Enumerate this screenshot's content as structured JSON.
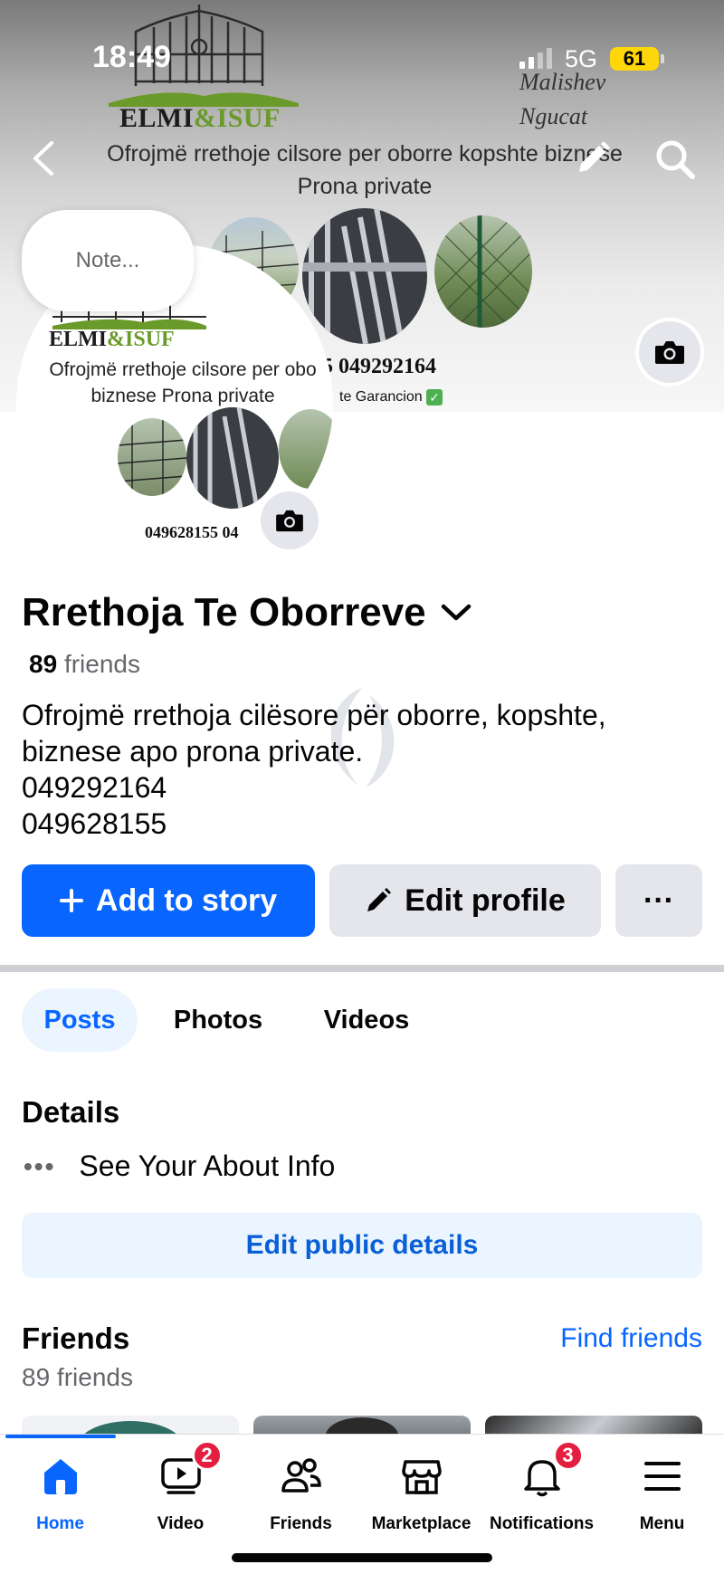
{
  "status_bar": {
    "time": "18:49",
    "network": "5G",
    "battery": "61"
  },
  "cover": {
    "brand_name": "ELMI",
    "brand_amp": "&",
    "brand_name_2": "ISUF",
    "tagline": "Ofrojmë rrethoje cilsore per oborre kopshte biznese Prona private",
    "handwritten_line1": "Malishev",
    "handwritten_line2": "Ngucat",
    "phone": "55  049292164",
    "garancion": "te Garancion"
  },
  "profile_picture": {
    "brand_name": "ELMI",
    "brand_amp": "&",
    "brand_name_2": "ISUF",
    "tagline": "Ofrojmë rrethoje cilsore per obo biznese Prona private",
    "phone": "049628155  04"
  },
  "note": {
    "placeholder": "Note..."
  },
  "profile": {
    "name": "Rrethoja Te Oborreve",
    "friends_count": "89",
    "friends_label": "friends",
    "bio_lines": [
      "Ofrojmë rrethoja cilësore për oborre, kopshte,",
      "biznese apo prona private.",
      "049292164",
      "049628155"
    ]
  },
  "actions": {
    "add_to_story": "Add to story",
    "edit_profile": "Edit profile",
    "more": "···"
  },
  "tabs": [
    "Posts",
    "Photos",
    "Videos"
  ],
  "details": {
    "title": "Details",
    "about_dots": "•••",
    "about_link": "See Your About Info",
    "edit_button": "Edit public details"
  },
  "friends_section": {
    "title": "Friends",
    "find_friends": "Find friends",
    "count_text": "89 friends"
  },
  "bottom_nav": {
    "items": [
      {
        "label": "Home",
        "icon": "home-icon",
        "active": true
      },
      {
        "label": "Video",
        "icon": "video-icon",
        "badge": "2"
      },
      {
        "label": "Friends",
        "icon": "friends-icon"
      },
      {
        "label": "Marketplace",
        "icon": "marketplace-icon"
      },
      {
        "label": "Notifications",
        "icon": "bell-icon",
        "badge": "3"
      },
      {
        "label": "Menu",
        "icon": "menu-icon"
      }
    ]
  },
  "colors": {
    "accent": "#0866ff",
    "secondary_button": "#e4e6eb",
    "badge": "#e41e3f",
    "brand_green": "#6a9a2a"
  }
}
